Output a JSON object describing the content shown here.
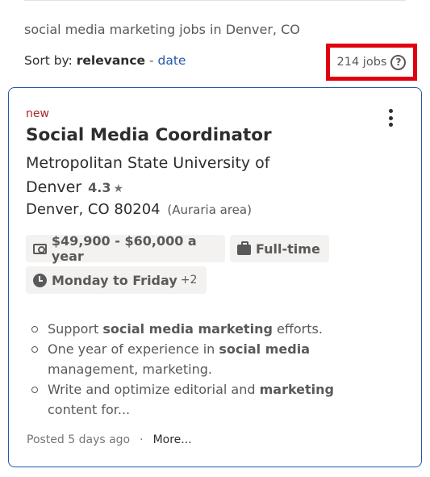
{
  "search": {
    "summary": "social media marketing jobs in Denver, CO",
    "sort_prefix": "Sort by:",
    "sort_active": "relevance",
    "sort_separator": "-",
    "sort_alt": "date",
    "count": "214 jobs",
    "help_glyph": "?"
  },
  "job": {
    "badge": "new",
    "title": "Social Media Coordinator",
    "company": "Metropolitan State University of Denver",
    "rating": "4.3",
    "rating_icon": "star-icon",
    "location": "Denver, CO 80204",
    "location_area": "(Auraria area)",
    "chips": {
      "salary": "$49,900 - $60,000 a year",
      "job_type": "Full-time",
      "schedule": "Monday to Friday",
      "schedule_extra": "+2"
    },
    "snippet": [
      {
        "pre": "Support ",
        "bold": "social media marketing",
        "post": " efforts."
      },
      {
        "pre": "One year of experience in ",
        "bold": "social media",
        "post": " management, marketing."
      },
      {
        "pre": "Write and optimize editorial and ",
        "bold": "marketing",
        "post": " content for..."
      }
    ],
    "posted": "Posted 5 days ago",
    "footer_separator": "·",
    "more": "More..."
  },
  "colors": {
    "accent": "#2557a7",
    "highlight_box": "#e0000f",
    "new_badge": "#a9252b",
    "chip_bg": "#f3f2f1"
  }
}
